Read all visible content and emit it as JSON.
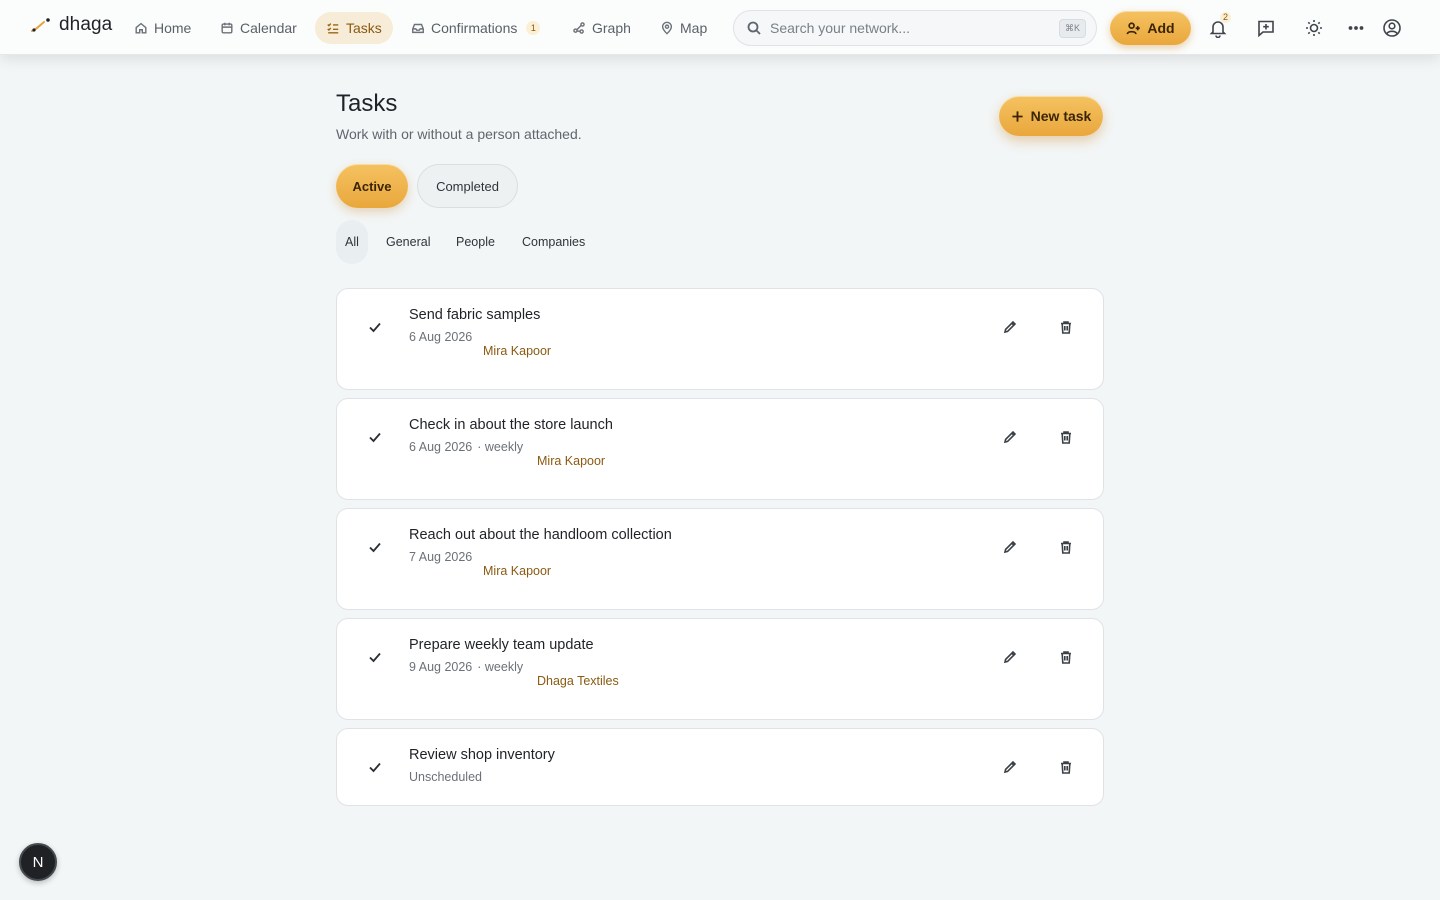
{
  "brand": {
    "name": "dhaga",
    "logo_icon": "thread-logo-icon"
  },
  "nav": [
    {
      "label": "Home",
      "icon": "home-icon"
    },
    {
      "label": "Calendar",
      "icon": "calendar-icon"
    },
    {
      "label": "Tasks",
      "icon": "list-check-icon",
      "active": true
    },
    {
      "label": "Confirmations",
      "icon": "inbox-icon",
      "count": "1"
    },
    {
      "label": "Graph",
      "icon": "graph-icon"
    },
    {
      "label": "Map",
      "icon": "map-pin-icon"
    }
  ],
  "search": {
    "placeholder": "Search your network...",
    "shortcut": "⌘K",
    "value": ""
  },
  "header_actions": {
    "add_label": "Add",
    "notification_count": "2"
  },
  "page": {
    "title": "Tasks",
    "subtitle": "Work with or without a person attached.",
    "new_task_label": "New task"
  },
  "status_tabs": [
    {
      "label": "Active",
      "selected": true
    },
    {
      "label": "Completed",
      "selected": false
    }
  ],
  "filter_tabs": [
    {
      "label": "All",
      "selected": true
    },
    {
      "label": "General"
    },
    {
      "label": "People"
    },
    {
      "label": "Companies"
    }
  ],
  "tasks": [
    {
      "title": "Send fabric samples",
      "date": "6 Aug 2026",
      "recurrence": "",
      "person": "Mira Kapoor"
    },
    {
      "title": "Check in about the store launch",
      "date": "6 Aug 2026",
      "recurrence": "· weekly",
      "person": "Mira Kapoor"
    },
    {
      "title": "Reach out about the handloom collection",
      "date": "7 Aug 2026",
      "recurrence": "",
      "person": "Mira Kapoor"
    },
    {
      "title": "Prepare weekly team update",
      "date": "9 Aug 2026",
      "recurrence": "· weekly",
      "person": "Dhaga Textiles"
    },
    {
      "title": "Review shop inventory",
      "date": "Unscheduled",
      "recurrence": "",
      "person": ""
    }
  ],
  "floating_badge": {
    "label": "N"
  },
  "colors": {
    "accent": "#eeb04b",
    "accent_text": "#8a5a12",
    "background": "#f3f6f7"
  }
}
